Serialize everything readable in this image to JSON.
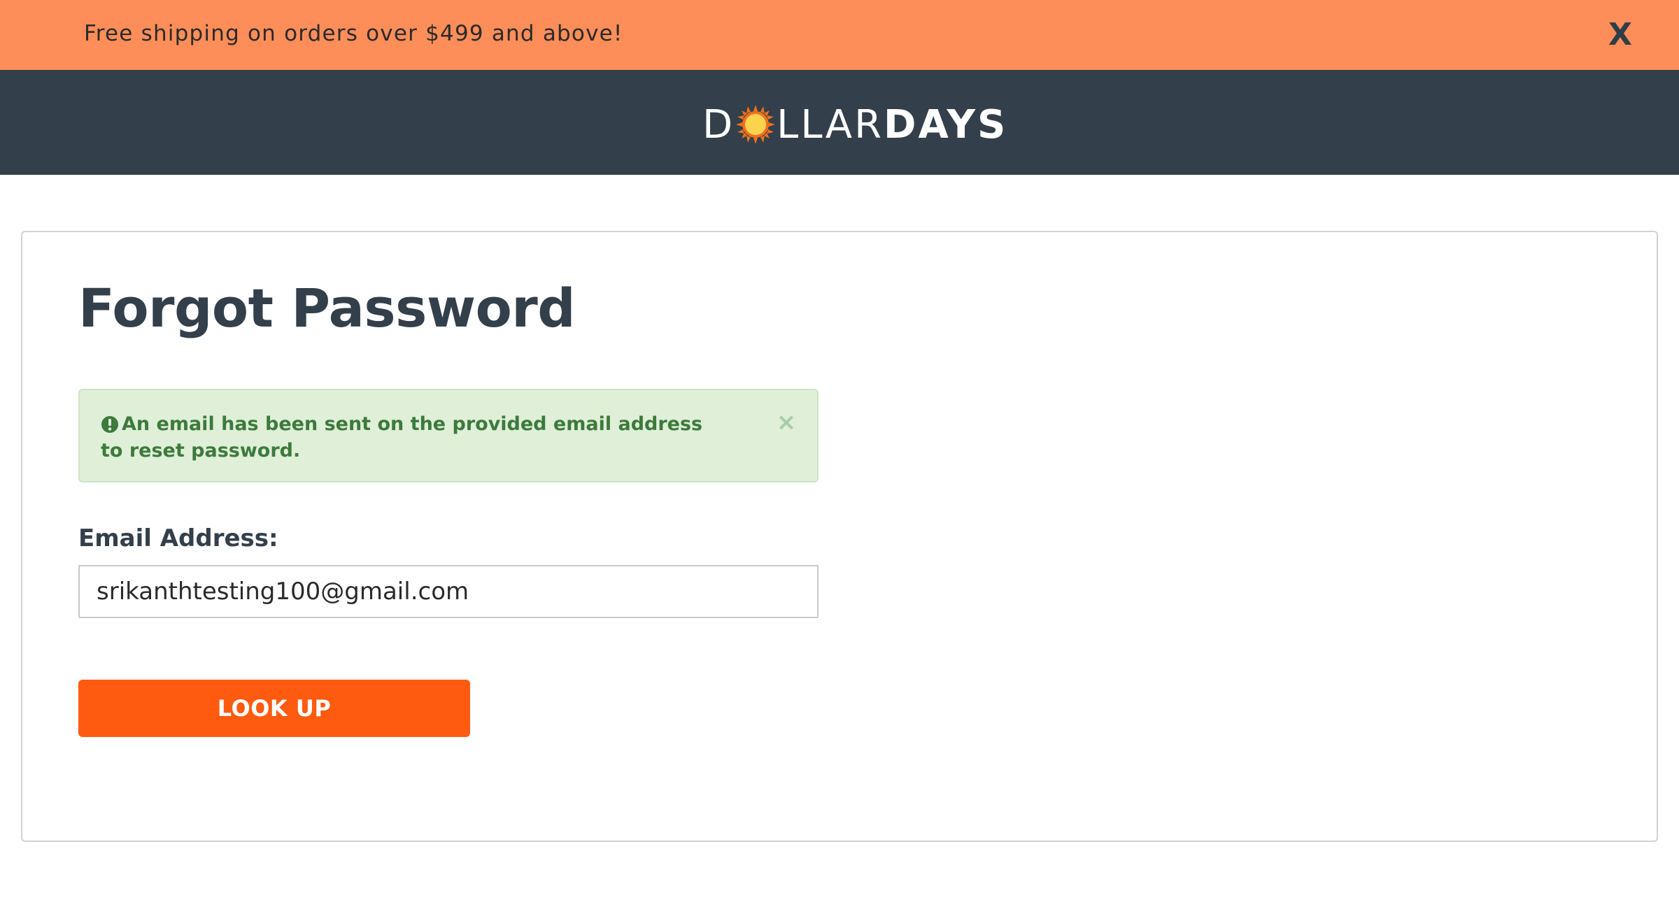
{
  "promo": {
    "text": "Free shipping on orders over $499 and above!",
    "close_label": "X"
  },
  "header": {
    "logo_part1": "D",
    "logo_part2": "LLAR",
    "logo_part3": "DAYS",
    "logo_icon": "sun-icon"
  },
  "page": {
    "title": "Forgot Password"
  },
  "alert": {
    "message": "An email has been sent on the provided email address to reset password.",
    "close_label": "×",
    "icon": "exclamation-circle-icon",
    "color": "#3d7a3c",
    "background": "#dfefd8"
  },
  "form": {
    "email_label": "Email Address:",
    "email_value": "srikanthtesting100@gmail.com",
    "submit_label": "LOOK UP"
  },
  "colors": {
    "promo_bg": "#fe8e59",
    "header_bg": "#333f4a",
    "accent": "#fe5a10"
  }
}
